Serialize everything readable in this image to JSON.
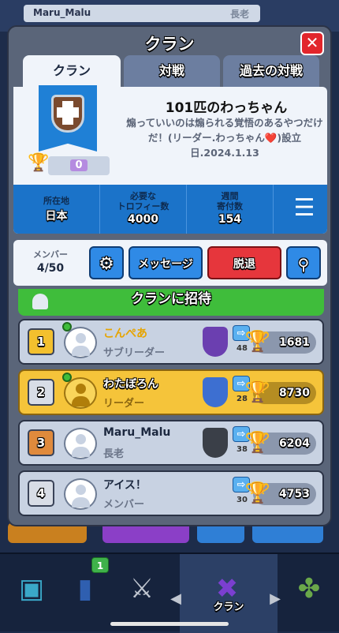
{
  "background": {
    "player_name": "Maru_Malu",
    "player_role": "長老"
  },
  "dialog": {
    "title": "クラン",
    "tabs": [
      "クラン",
      "対戦",
      "過去の対戦"
    ]
  },
  "clan": {
    "name": "101匹のわっちゃん",
    "description": "煽っていいのは煽られる覚悟のあるやつだけだ！(リーダー.わっちゃん❤️)設立日.2024.1.13",
    "trophies": "0",
    "stats": [
      {
        "label": "所在地",
        "value": "日本"
      },
      {
        "label": "必要な\nトロフィー数",
        "value": "4000"
      },
      {
        "label": "週間\n寄付数",
        "value": "154"
      }
    ]
  },
  "members_bar": {
    "label": "メンバー",
    "count": "4/50",
    "message_button": "メッセージ",
    "leave_button": "脱退"
  },
  "invite_label": "クランに招待",
  "members": [
    {
      "rank": "1",
      "name": "こんぺあ",
      "role": "サブリーダー",
      "donations": "48",
      "trophies": "1681",
      "online": true,
      "highlight": false,
      "league_color": "#6b3fb0",
      "rank_color": "#f3c02e",
      "name_color": "#e6a400"
    },
    {
      "rank": "2",
      "name": "わたぼろん",
      "role": "リーダー",
      "donations": "28",
      "trophies": "8730",
      "online": true,
      "highlight": true,
      "league_color": "#3d6fd1",
      "rank_color": "#d8dde6",
      "name_color": "#ffffff"
    },
    {
      "rank": "3",
      "name": "Maru_Malu",
      "role": "長老",
      "donations": "38",
      "trophies": "6204",
      "online": false,
      "highlight": false,
      "league_color": "#3a3f48",
      "rank_color": "#e08a3c",
      "name_color": "#ffffff"
    },
    {
      "rank": "4",
      "name": "アイス！",
      "role": "メンバー",
      "donations": "30",
      "trophies": "4753",
      "online": false,
      "highlight": false,
      "league_color": "",
      "rank_color": "#d8dde6",
      "name_color": "#ffffff"
    }
  ],
  "bottom_nav": {
    "active_label": "クラン",
    "cards_badge": "1"
  }
}
